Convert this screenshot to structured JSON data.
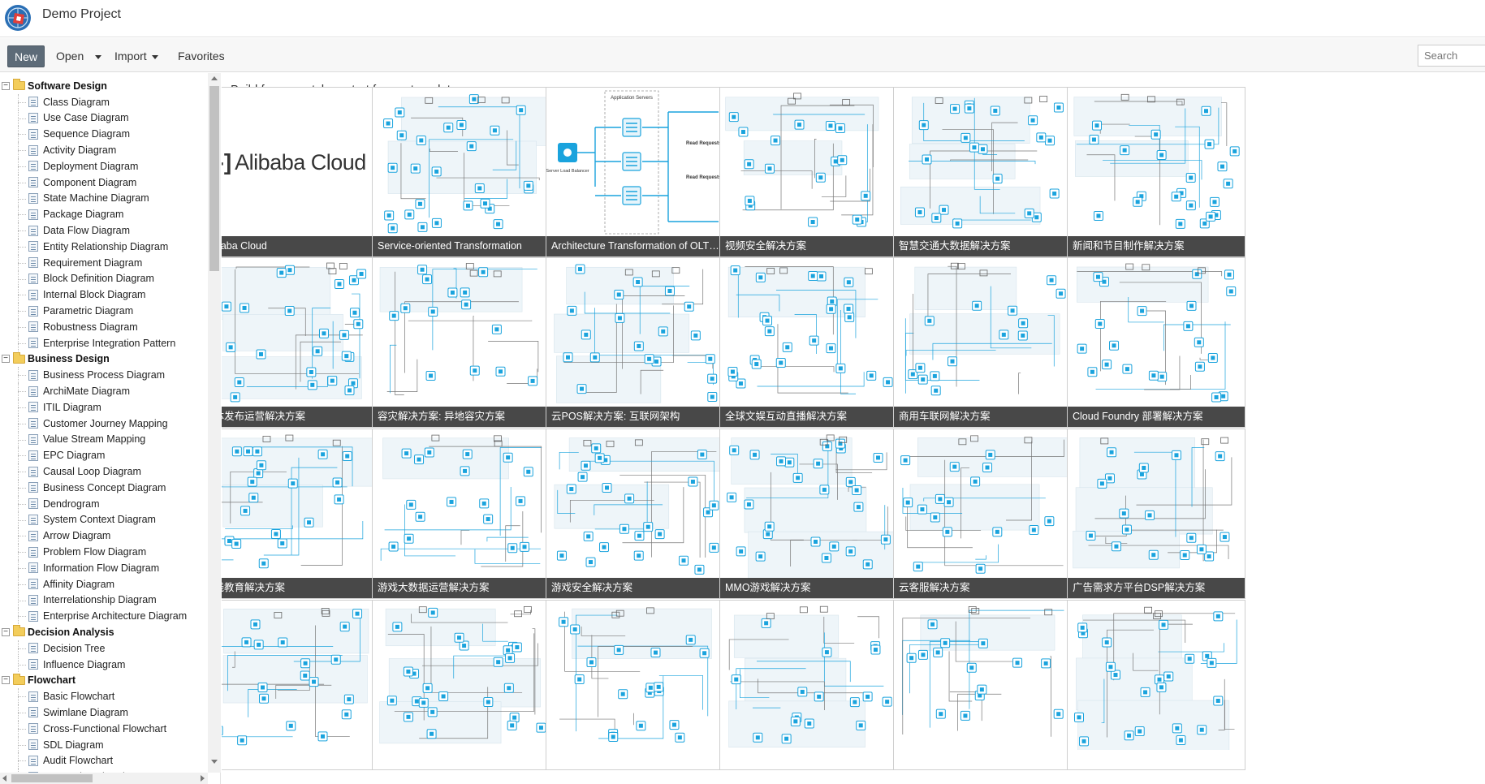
{
  "app": {
    "title": "Demo Project"
  },
  "toolbar": {
    "new_label": "New",
    "open_label": "Open",
    "import_label": "Import",
    "favorites_label": "Favorites",
    "search_placeholder": "Search"
  },
  "sidebar": {
    "categories": [
      {
        "name": "Software Design",
        "items": [
          "Class Diagram",
          "Use Case Diagram",
          "Sequence Diagram",
          "Activity Diagram",
          "Deployment Diagram",
          "Component Diagram",
          "State Machine Diagram",
          "Package Diagram",
          "Data Flow Diagram",
          "Entity Relationship Diagram",
          "Requirement Diagram",
          "Block Definition Diagram",
          "Internal Block Diagram",
          "Parametric Diagram",
          "Robustness Diagram",
          "Enterprise Integration Pattern"
        ]
      },
      {
        "name": "Business Design",
        "items": [
          "Business Process Diagram",
          "ArchiMate Diagram",
          "ITIL Diagram",
          "Customer Journey Mapping",
          "Value Stream Mapping",
          "EPC Diagram",
          "Causal Loop Diagram",
          "Business Concept Diagram",
          "Dendrogram",
          "System Context Diagram",
          "Arrow Diagram",
          "Problem Flow Diagram",
          "Information Flow Diagram",
          "Affinity Diagram",
          "Interrelationship Diagram",
          "Enterprise Architecture Diagram"
        ]
      },
      {
        "name": "Decision Analysis",
        "items": [
          "Decision Tree",
          "Influence Diagram"
        ]
      },
      {
        "name": "Flowchart",
        "items": [
          "Basic Flowchart",
          "Swimlane Diagram",
          "Cross-Functional Flowchart",
          "SDL Diagram",
          "Audit Flowchart",
          "Accounting Flowchart"
        ]
      }
    ]
  },
  "main": {
    "heading": "Build from scratch or start from a template",
    "alibaba_logo_text": "Alibaba Cloud",
    "templates": [
      {
        "label": "Alibaba Cloud",
        "kind": "logo"
      },
      {
        "label": "Service-oriented Transformation",
        "kind": "diagram"
      },
      {
        "label": "Architecture Transformation of OLTP-...",
        "kind": "olap"
      },
      {
        "label": "视频安全解决方案",
        "kind": "diagram"
      },
      {
        "label": "智慧交通大数据解决方案",
        "kind": "diagram"
      },
      {
        "label": "新闻和节目制作解决方案",
        "kind": "diagram"
      },
      {
        "label": "媒体发布运营解决方案",
        "kind": "diagram"
      },
      {
        "label": "容灾解决方案: 异地容灾方案",
        "kind": "diagram"
      },
      {
        "label": "云POS解决方案: 互联网架构",
        "kind": "diagram"
      },
      {
        "label": "全球文娱互动直播解决方案",
        "kind": "diagram"
      },
      {
        "label": "商用车联网解决方案",
        "kind": "diagram"
      },
      {
        "label": "Cloud Foundry 部署解决方案",
        "kind": "diagram"
      },
      {
        "label": "在线教育解决方案",
        "kind": "diagram"
      },
      {
        "label": "游戏大数据运营解决方案",
        "kind": "diagram"
      },
      {
        "label": "游戏安全解决方案",
        "kind": "diagram"
      },
      {
        "label": "MMO游戏解决方案",
        "kind": "diagram"
      },
      {
        "label": "云客服解决方案",
        "kind": "diagram"
      },
      {
        "label": "广告需求方平台DSP解决方案",
        "kind": "diagram"
      },
      {
        "label": "",
        "kind": "diagram"
      },
      {
        "label": "",
        "kind": "diagram"
      },
      {
        "label": "",
        "kind": "diagram"
      },
      {
        "label": "",
        "kind": "diagram"
      },
      {
        "label": "",
        "kind": "diagram"
      },
      {
        "label": "",
        "kind": "diagram"
      }
    ],
    "olap_labels": {
      "app_servers": "Application Servers",
      "slb": "Server Load Balancer",
      "read_requests": "Read Requests"
    }
  },
  "colors": {
    "accent": "#1aa3dd",
    "new_button": "#5d6b78",
    "folder": "#f3cd5b",
    "card_label_bg": "#282828"
  }
}
